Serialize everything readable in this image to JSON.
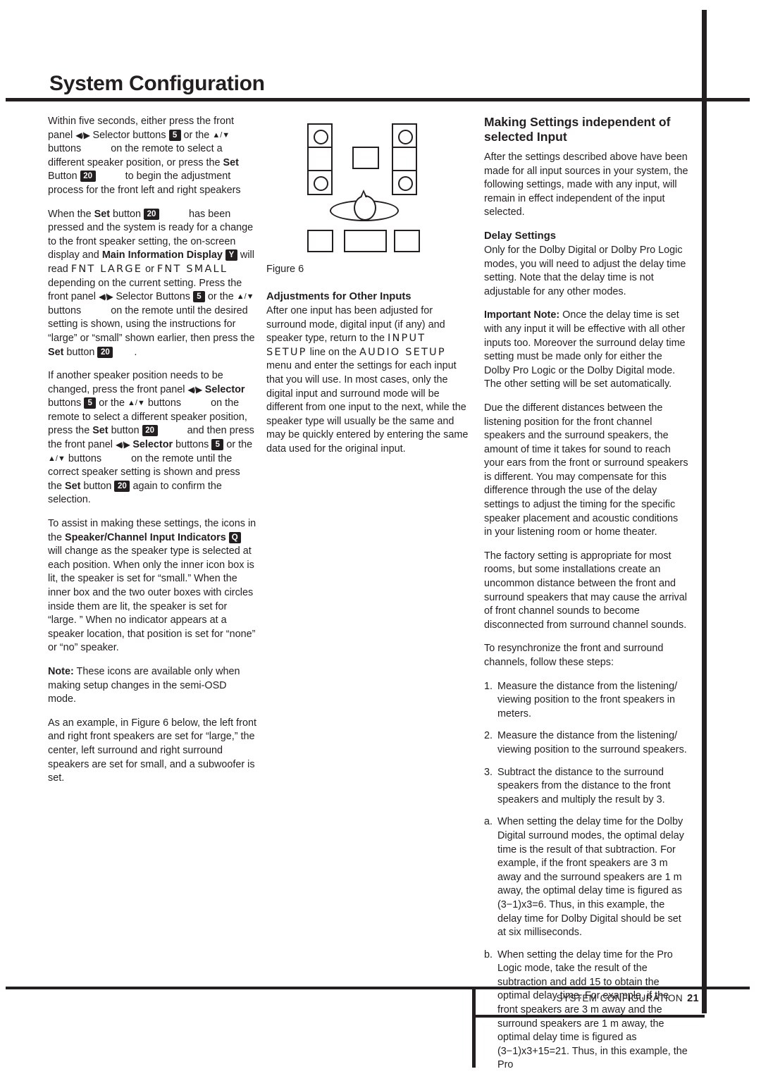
{
  "page": {
    "title": "System Configuration",
    "footer_label": "SYSTEM CONFIGURATION",
    "footer_page_number": "21"
  },
  "badges": {
    "selector": "5",
    "set": "20",
    "main_info_display": "Y",
    "speaker_channel_indicators": "Q"
  },
  "left_column": {
    "p1_a": "Within five seconds, either press the front panel",
    "p1_arrows_lr": "◀/▶",
    "p1_b": "Selector buttons",
    "p1_c": "or the",
    "p1_arrows_ud": "▲/▼",
    "p1_d": "buttons",
    "p1_e": "on the remote to select a different speaker position, or press the",
    "p1_set": "Set",
    "p1_f": "Button",
    "p1_g": "to begin the adjustment process for the front left and right speakers",
    "p2_a": "When the",
    "p2_set": "Set",
    "p2_b": "button",
    "p2_c": "has been pressed and the system is ready for a change to the front speaker setting, the on-screen display and",
    "p2_bold1": "Main Information Display",
    "p2_d": "will read",
    "p2_lcd1": "FNT LARGE",
    "p2_e": "or",
    "p2_lcd2": "FNT SMALL",
    "p2_f": "depending on the current setting. Press the front panel",
    "p2_arrows_lr": "◀/▶",
    "p2_g": "Selector Buttons",
    "p2_h": "or the",
    "p2_arrows_ud": "▲/▼",
    "p2_i": "buttons",
    "p2_j": "on the remote until the desired setting is shown, using the instructions for “large” or “small” shown earlier, then press the",
    "p2_set2": "Set",
    "p2_k": "button",
    "p2_l": ".",
    "p3_a": "If another speaker position needs to be changed, press the front panel",
    "p3_arrows_lr": "◀/▶",
    "p3_bold1": "Selector",
    "p3_b": "buttons",
    "p3_c": "or the",
    "p3_arrows_ud": "▲/▼",
    "p3_d": "buttons",
    "p3_e": "on the remote to select a different speaker position, press the",
    "p3_set": "Set",
    "p3_f": "button",
    "p3_g": "and then press the front panel",
    "p3_arrows_lr2": "◀/▶",
    "p3_bold2": "Selector",
    "p3_h": "buttons",
    "p3_i": "or the",
    "p3_arrows_ud2": "▲/▼",
    "p3_j": "buttons",
    "p3_k": "on the remote until the correct speaker setting is shown and press the",
    "p3_set2": "Set",
    "p3_l": "button",
    "p3_m": "again to confirm the selection.",
    "p4_a": "To assist in making these settings, the icons in the",
    "p4_bold": "Speaker/Channel Input Indicators",
    "p4_b": "will change as the speaker type is selected at each position. When only the inner icon box is lit, the speaker is set for “small.” When the inner box and the two outer boxes with circles inside them are lit, the speaker is set for “large. ” When no indicator appears at a speaker location, that position is set for “none” or “no” speaker.",
    "p5_bold": "Note:",
    "p5_text": "These icons are available only when making setup changes in the semi-OSD mode.",
    "p6": "As an example, in Figure 6 below, the left front and right front speakers are set for “large,” the center, left surround and right surround speakers are set for small, and a subwoofer is set."
  },
  "middle_column": {
    "figure_caption": "Figure 6",
    "heading": "Adjustments for Other Inputs",
    "p1_a": "After one input has been adjusted for surround mode, digital input (if any) and speaker type, return to the",
    "p1_lcd1": "INPUT SETUP",
    "p1_b": "line on the",
    "p1_lcd2": "AUDIO SETUP",
    "p1_c": "menu and enter the settings for each input that you will use. In most cases, only the digital input and surround mode will be different from one input to the next, while the speaker type will usually be the same and may be quickly entered by entering the same data used for the original input."
  },
  "right_column": {
    "heading": "Making Settings independent of selected Input",
    "p1": "After the settings described above have been made for all input sources in your system, the following settings, made with any input, will remain in effect independent of the input selected.",
    "subhead": "Delay Settings",
    "p2": "Only for the Dolby Digital or Dolby Pro Logic modes, you will need to adjust the delay time setting. Note that the delay time is not adjustable for any other modes.",
    "p3_bold": "Important Note:",
    "p3_text": "Once the delay time is set with any input it will be effective with all other inputs too. Moreover the surround delay time setting must be made only for either the Dolby Pro Logic or the Dolby Digital mode. The other setting will be set automatically.",
    "p4": "Due the different distances between the listening position for the front channel speakers and the surround speakers, the amount of time it takes for sound to reach your ears from the front or surround speakers is different. You may compensate for this difference through the use of the delay settings to adjust the timing for the specific speaker placement and acoustic conditions in your listening room or home theater.",
    "p5": "The factory setting is appropriate for most rooms, but some installations create an uncommon distance between the front and surround speakers that may cause the arrival of front channel sounds to become disconnected from surround channel sounds.",
    "p6": "To resynchronize the front and surround channels, follow these steps:",
    "steps": [
      {
        "marker": "1.",
        "text": "Measure the distance from the listening/ viewing position to the front speakers in meters."
      },
      {
        "marker": "2.",
        "text": "Measure the distance from the listening/ viewing position to the surround speakers."
      },
      {
        "marker": "3.",
        "text": "Subtract the distance to the surround speakers from the distance to the front speakers and multiply the result by 3."
      },
      {
        "marker": "a.",
        "text": "When setting the delay time for the Dolby Digital surround modes, the optimal delay time is the result of that subtraction. For example, if the front speakers are 3 m away and the surround speakers are 1 m away, the optimal delay time is figured as (3−1)x3=6. Thus, in this example, the delay time for Dolby Digital should be set at six milliseconds."
      },
      {
        "marker": "b.",
        "text": "When setting the delay time for the Pro Logic mode, take the result of the subtraction and add 15 to obtain the optimal delay time. For example, if the front speakers are 3 m away and the surround speakers are 1 m away, the optimal delay time is figured as (3−1)x3+15=21. Thus, in this example, the Pro"
      }
    ]
  },
  "figure": {
    "name": "Figure 6",
    "description": "Speaker/Channel Input Indicator layout diagram",
    "speakers": [
      {
        "position": "left-front",
        "setting": "large"
      },
      {
        "position": "center",
        "setting": "small"
      },
      {
        "position": "right-front",
        "setting": "large"
      },
      {
        "position": "left-surround",
        "setting": "small"
      },
      {
        "position": "subwoofer",
        "setting": "set"
      },
      {
        "position": "right-surround",
        "setting": "small"
      }
    ]
  },
  "colors": {
    "ink": "#231f20",
    "paper": "#ffffff"
  }
}
